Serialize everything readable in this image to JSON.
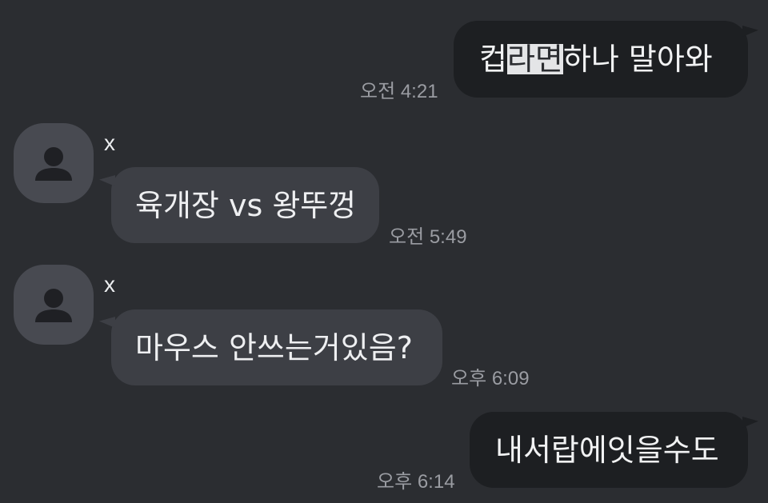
{
  "messages": [
    {
      "direction": "outgoing",
      "text_before": "컵",
      "text_highlight": "라면",
      "text_after": " 하나 말아와",
      "time": "오전 4:21"
    },
    {
      "direction": "incoming",
      "sender": "x",
      "text": "육개장 vs 왕뚜껑",
      "time": "오전 5:49"
    },
    {
      "direction": "incoming",
      "sender": "x",
      "text": "마우스 안쓰는거있음?",
      "time": "오후 6:09"
    },
    {
      "direction": "outgoing",
      "text": "내서랍에잇을수도",
      "time": "오후 6:14"
    }
  ],
  "colors": {
    "background": "#2b2d31",
    "outgoing_bubble": "#1d1f22",
    "incoming_bubble": "#3d3f45",
    "timestamp": "#9a9ca2",
    "highlight": "#e4e5e7"
  },
  "icons": {
    "avatar": "person-icon"
  }
}
